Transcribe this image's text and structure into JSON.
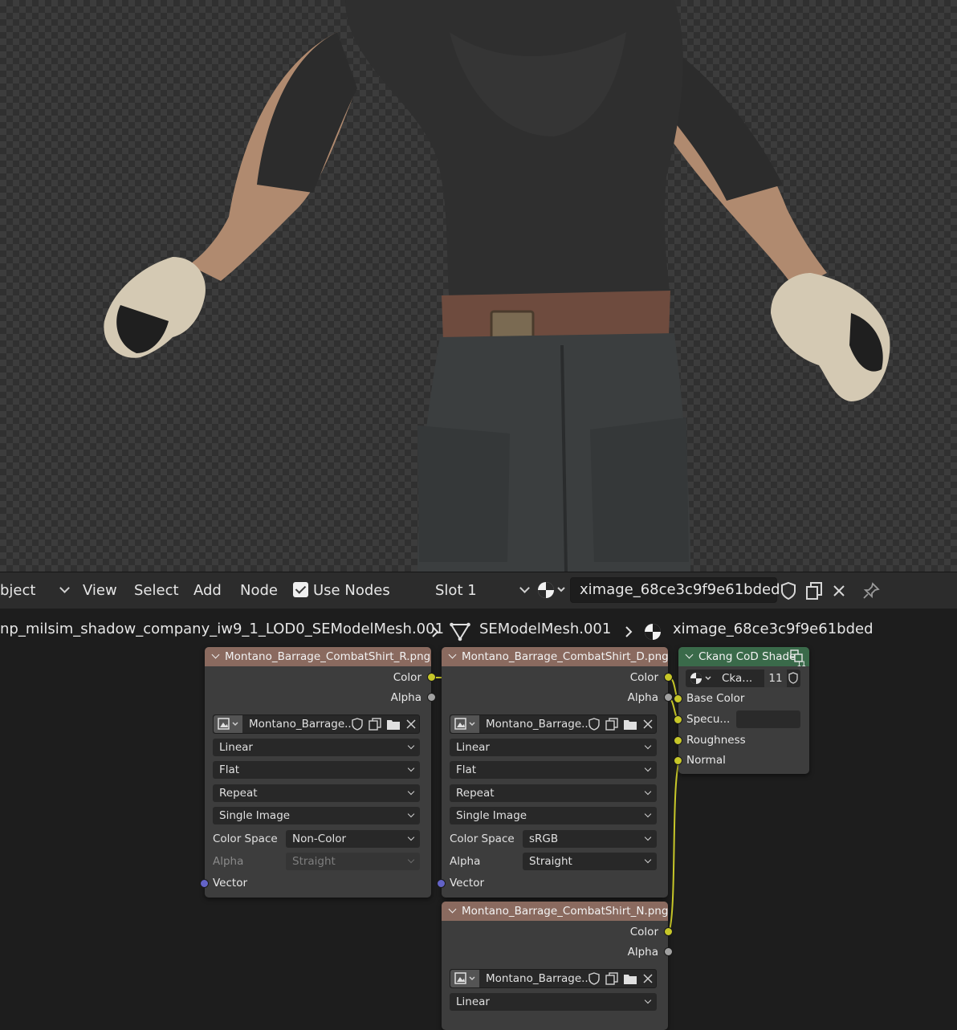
{
  "header": {
    "object_label": "bject",
    "menus": [
      "View",
      "Select",
      "Add",
      "Node"
    ],
    "use_nodes_label": "Use Nodes",
    "slot_label": "Slot 1",
    "material_name": "ximage_68ce3c9f9e61bded"
  },
  "breadcrumb": {
    "object_name": "np_milsim_shadow_company_iw9_1_LOD0_SEModelMesh.001",
    "mesh_name": "SEModelMesh.001",
    "material_name": "ximage_68ce3c9f9e61bded"
  },
  "nodes": {
    "tex_r": {
      "title": "Montano_Barrage_CombatShirt_R.png",
      "out_color": "Color",
      "out_alpha": "Alpha",
      "image_name": "Montano_Barrage...",
      "interpolation": "Linear",
      "projection": "Flat",
      "extension": "Repeat",
      "source": "Single Image",
      "color_space_label": "Color Space",
      "color_space": "Non-Color",
      "alpha_label": "Alpha",
      "alpha_mode": "Straight",
      "vector_label": "Vector"
    },
    "tex_d": {
      "title": "Montano_Barrage_CombatShirt_D.png",
      "out_color": "Color",
      "out_alpha": "Alpha",
      "image_name": "Montano_Barrage...",
      "interpolation": "Linear",
      "projection": "Flat",
      "extension": "Repeat",
      "source": "Single Image",
      "color_space_label": "Color Space",
      "color_space": "sRGB",
      "alpha_label": "Alpha",
      "alpha_mode": "Straight",
      "vector_label": "Vector"
    },
    "tex_n": {
      "title": "Montano_Barrage_CombatShirt_N.png",
      "out_color": "Color",
      "out_alpha": "Alpha",
      "image_name": "Montano_Barrage...",
      "interpolation": "Linear"
    },
    "shader": {
      "title": "Ckang CoD Shader",
      "group_name": "Cka...",
      "users": "11",
      "badge": "11",
      "inputs": [
        "Base Color",
        "Specu...",
        "Roughness",
        "Normal"
      ]
    }
  },
  "colors": {
    "texture_header": "#8a6a5f",
    "shader_header": "#3a6a4a",
    "socket_color": "#c7c729",
    "socket_grey": "#a1a1a1",
    "socket_vector": "#6363c7"
  }
}
